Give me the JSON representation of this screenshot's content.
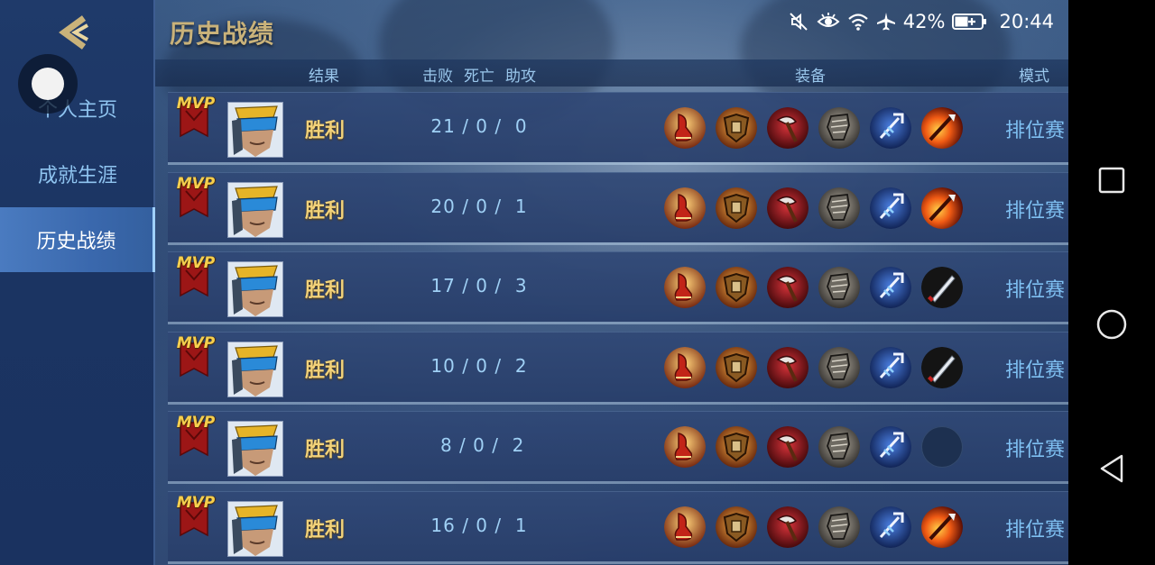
{
  "header": {
    "title": "历史战绩",
    "back_icon": "back-chevron-icon"
  },
  "status_bar": {
    "battery_percent": "42%",
    "time": "20:44",
    "icons": [
      "mute-icon",
      "eye-icon",
      "wifi-icon",
      "airplane-icon",
      "battery-charging-icon"
    ]
  },
  "sidebar": {
    "items": [
      {
        "label": "个人主页",
        "active": false
      },
      {
        "label": "成就生涯",
        "active": false
      },
      {
        "label": "历史战绩",
        "active": true
      }
    ]
  },
  "columns": {
    "result": "结果",
    "kills": "击败",
    "deaths": "死亡",
    "assists": "助攻",
    "equipment": "装备",
    "mode": "模式"
  },
  "matches": [
    {
      "mvp": "MVP",
      "result": "胜利",
      "kda": "21 / 0 /  0",
      "items": [
        "boots-item-icon",
        "shield-item-icon",
        "axe-item-icon",
        "armor-item-icon",
        "trident-item-icon",
        "fire-spear-item-icon"
      ],
      "mode": "排位赛"
    },
    {
      "mvp": "MVP",
      "result": "胜利",
      "kda": "20 / 0 /  1",
      "items": [
        "boots-item-icon",
        "shield-item-icon",
        "axe-item-icon",
        "armor-item-icon",
        "trident-item-icon",
        "fire-spear-item-icon"
      ],
      "mode": "排位赛"
    },
    {
      "mvp": "MVP",
      "result": "胜利",
      "kda": "17 / 0 /  3",
      "items": [
        "boots-item-icon",
        "shield-item-icon",
        "axe-item-icon",
        "armor-item-icon",
        "trident-item-icon",
        "blade-item-icon"
      ],
      "mode": "排位赛"
    },
    {
      "mvp": "MVP",
      "result": "胜利",
      "kda": "10 / 0 /  2",
      "items": [
        "boots-item-icon",
        "shield-item-icon",
        "axe-item-icon",
        "armor-item-icon",
        "trident-item-icon",
        "blade-item-icon"
      ],
      "mode": "排位赛"
    },
    {
      "mvp": "MVP",
      "result": "胜利",
      "kda": " 8 / 0 /  2",
      "items": [
        "boots-item-icon",
        "shield-item-icon",
        "axe-item-icon",
        "armor-item-icon",
        "trident-item-icon",
        "empty-slot"
      ],
      "mode": "排位赛"
    },
    {
      "mvp": "MVP",
      "result": "胜利",
      "kda": "16 / 0 /  1",
      "items": [
        "boots-item-icon",
        "shield-item-icon",
        "axe-item-icon",
        "armor-item-icon",
        "trident-item-icon",
        "fire-spear-item-icon"
      ],
      "mode": "排位赛"
    }
  ],
  "colors": {
    "title_gold": "#c9b27a",
    "result_gold": "#f2d27a",
    "kda_blue": "#9fd0f5",
    "mode_blue": "#7fc0f2",
    "sidebar_active": "#4a7bc0"
  },
  "android_nav": {
    "icons": [
      "recents-square-icon",
      "home-circle-icon",
      "back-triangle-icon"
    ]
  }
}
